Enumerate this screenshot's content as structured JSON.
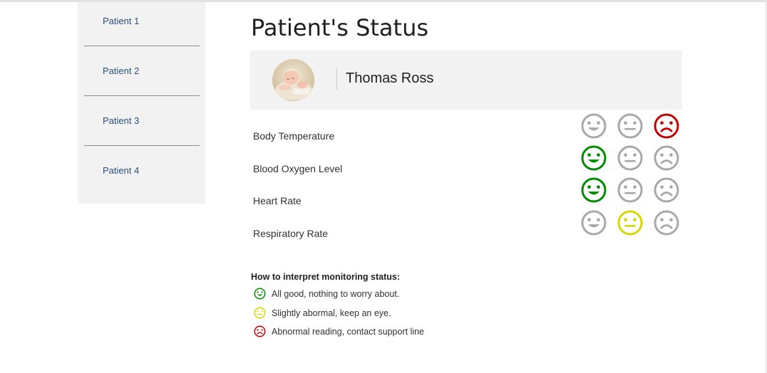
{
  "sidebar": {
    "items": [
      {
        "label": "Patient 1"
      },
      {
        "label": "Patient 2"
      },
      {
        "label": "Patient 3"
      },
      {
        "label": "Patient 4"
      }
    ]
  },
  "page": {
    "title": "Patient's Status"
  },
  "patient": {
    "name": "Thomas Ross",
    "avatar": "baby-photo"
  },
  "status_columns": [
    "good",
    "slightly-abnormal",
    "abnormal"
  ],
  "metrics": [
    {
      "label": "Body Temperature",
      "status": "abnormal"
    },
    {
      "label": "Blood Oxygen Level",
      "status": "good"
    },
    {
      "label": "Heart Rate",
      "status": "good"
    },
    {
      "label": "Respiratory Rate",
      "status": "slightly-abnormal"
    }
  ],
  "colors": {
    "good": "#008a00",
    "slightly-abnormal": "#d6d600",
    "abnormal": "#c50000",
    "inactive": "#a8a8a8"
  },
  "legend": {
    "title": "How to interpret monitoring status:",
    "items": [
      {
        "icon": "smiley-happy-icon",
        "status": "good",
        "text": "All good, nothing to worry about."
      },
      {
        "icon": "smiley-neutral-icon",
        "status": "slightly-abnormal",
        "text": "Slightly abormal, keep an eye."
      },
      {
        "icon": "smiley-sad-icon",
        "status": "abnormal",
        "text": "Abnormal reading, contact support line"
      }
    ]
  }
}
